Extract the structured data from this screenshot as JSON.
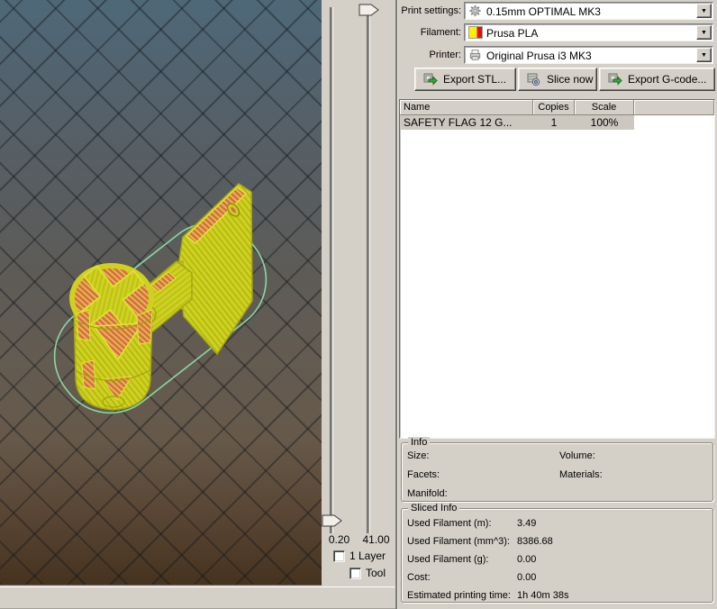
{
  "colors": {
    "window_bg": "#d4d0c8",
    "viewport_top": "#4e6878",
    "viewport_bottom": "#45331f",
    "model_yellow": "#ced11d",
    "model_yellow_dark": "#8e9212",
    "infill_red": "#e06262",
    "infill_gap_yellow": "#d6ca25",
    "skirt_teal": "#88d9a6",
    "filament_swatch_yellow": "#ffee00",
    "filament_swatch_red": "#dd1111",
    "selected_row_bg": "#ccc8c0",
    "button_icon_green": "#3fa33f"
  },
  "presets": {
    "print_settings_label": "Print settings:",
    "print_settings_value": "0.15mm OPTIMAL MK3",
    "filament_label": "Filament:",
    "filament_value": "Prusa PLA",
    "printer_label": "Printer:",
    "printer_value": "Original Prusa i3 MK3"
  },
  "actions": {
    "export_stl": "Export STL...",
    "slice_now": "Slice now",
    "export_gcode": "Export G-code..."
  },
  "object_table": {
    "columns": [
      "Name",
      "Copies",
      "Scale"
    ],
    "rows": [
      {
        "name": "SAFETY FLAG 12 G...",
        "copies": "1",
        "scale": "100%"
      }
    ]
  },
  "info_box": {
    "title": "Info",
    "size_label": "Size:",
    "volume_label": "Volume:",
    "facets_label": "Facets:",
    "materials_label": "Materials:",
    "manifold_label": "Manifold:"
  },
  "sliced_info_box": {
    "title": "Sliced Info",
    "rows": [
      {
        "label": "Used Filament (m):",
        "value": "3.49"
      },
      {
        "label": "Used Filament (mm^3):",
        "value": "8386.68"
      },
      {
        "label": "Used Filament (g):",
        "value": "0.00"
      },
      {
        "label": "Cost:",
        "value": "0.00"
      },
      {
        "label": "Estimated printing time:",
        "value": "1h 40m 38s"
      }
    ]
  },
  "layer_view": {
    "low_value": "0.20",
    "high_value": "41.00",
    "one_layer_label": "1 Layer",
    "tool_label": "Tool",
    "one_layer_checked": false,
    "tool_checked": false
  },
  "viewport": {
    "model_name": "SAFETY FLAG sliced preview with skirt outline"
  }
}
